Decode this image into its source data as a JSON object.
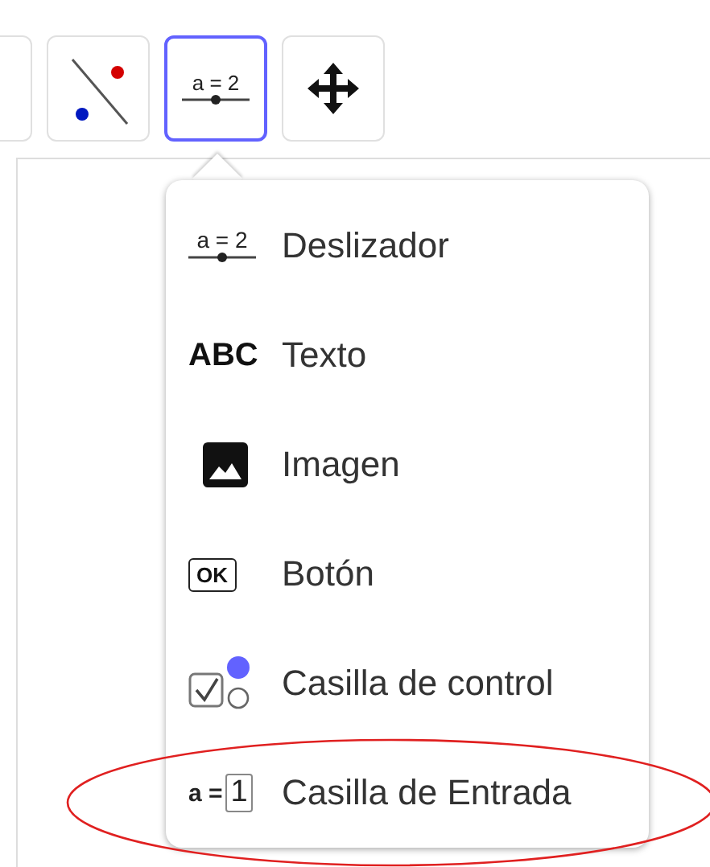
{
  "toolbar": [
    {
      "kind": "partial",
      "selected": false
    },
    {
      "kind": "line-points",
      "selected": false
    },
    {
      "kind": "slider",
      "selected": true,
      "icon_text": "a = 2"
    },
    {
      "kind": "move",
      "selected": false
    }
  ],
  "menu": {
    "items": [
      {
        "kind": "slider",
        "icon_text": "a = 2",
        "label": "Deslizador"
      },
      {
        "kind": "text",
        "icon_text": "ABC",
        "label": "Texto"
      },
      {
        "kind": "image",
        "label": "Imagen"
      },
      {
        "kind": "button",
        "icon_text": "OK",
        "label": "Botón"
      },
      {
        "kind": "checkbox",
        "label": "Casilla de control"
      },
      {
        "kind": "input",
        "icon_text": "a =",
        "icon_value": "1",
        "label": "Casilla de Entrada"
      }
    ]
  },
  "annotation": {
    "kind": "ellipse",
    "color": "#e02020"
  }
}
